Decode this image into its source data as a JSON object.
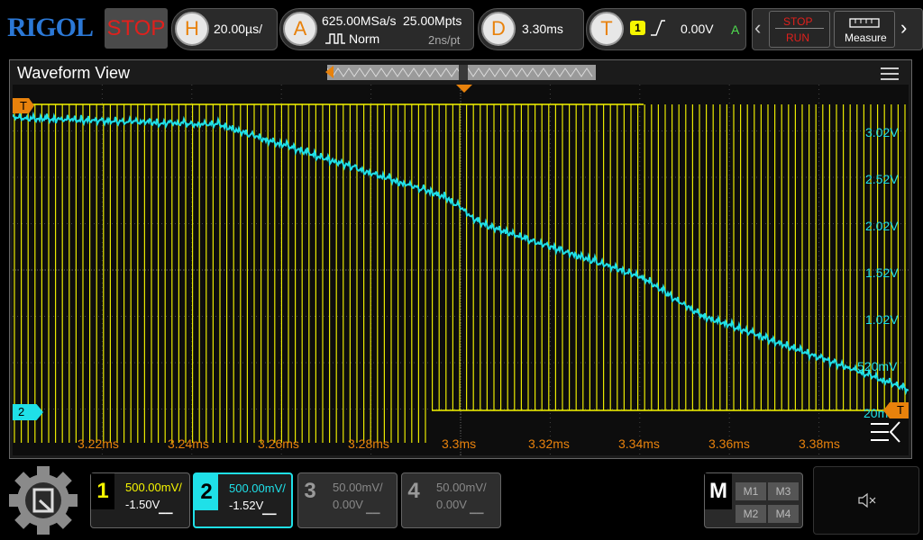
{
  "brand": "RIGOL",
  "run_state": "STOP",
  "horizontal": {
    "key": "H",
    "timebase": "20.00µs/"
  },
  "acquire": {
    "key": "A",
    "sample_rate": "625.00MSa/s",
    "mem_depth": "25.00Mpts",
    "mode": "Norm",
    "resolution": "2ns/pt"
  },
  "delay": {
    "key": "D",
    "value": "3.30ms"
  },
  "trigger": {
    "key": "T",
    "source": "1",
    "level": "0.00V",
    "mode_letter": "A"
  },
  "right_controls": {
    "stop_run_top": "STOP",
    "stop_run_bottom": "RUN",
    "measure": "Measure"
  },
  "waveform_view": {
    "title": "Waveform View",
    "trigger_marker": "T",
    "ch2_marker": "2",
    "trig_level_marker": "T",
    "y_labels": [
      "3.02V",
      "2.52V",
      "2.02V",
      "1.52V",
      "1.02V",
      "520mV",
      "20mV"
    ],
    "x_labels": [
      "3.22ms",
      "3.24ms",
      "3.26ms",
      "3.28ms",
      "3.3ms",
      "3.32ms",
      "3.34ms",
      "3.36ms",
      "3.38ms"
    ]
  },
  "channels": [
    {
      "num": "1",
      "scale": "500.00mV/",
      "offset": "-1.50V",
      "active": true,
      "color": "#f5f500"
    },
    {
      "num": "2",
      "scale": "500.00mV/",
      "offset": "-1.52V",
      "active": true,
      "color": "#1fe0e8"
    },
    {
      "num": "3",
      "scale": "50.00mV/",
      "offset": "0.00V",
      "active": false,
      "color": "#888888"
    },
    {
      "num": "4",
      "scale": "50.00mV/",
      "offset": "0.00V",
      "active": false,
      "color": "#888888"
    }
  ],
  "math": {
    "key": "M",
    "items": [
      "M1",
      "M3",
      "M2",
      "M4"
    ]
  },
  "colors": {
    "ch1": "#f5f500",
    "ch2": "#1fe0e8",
    "accent": "#e8820c",
    "stop": "#e0201c",
    "brand": "#2b78d6"
  }
}
